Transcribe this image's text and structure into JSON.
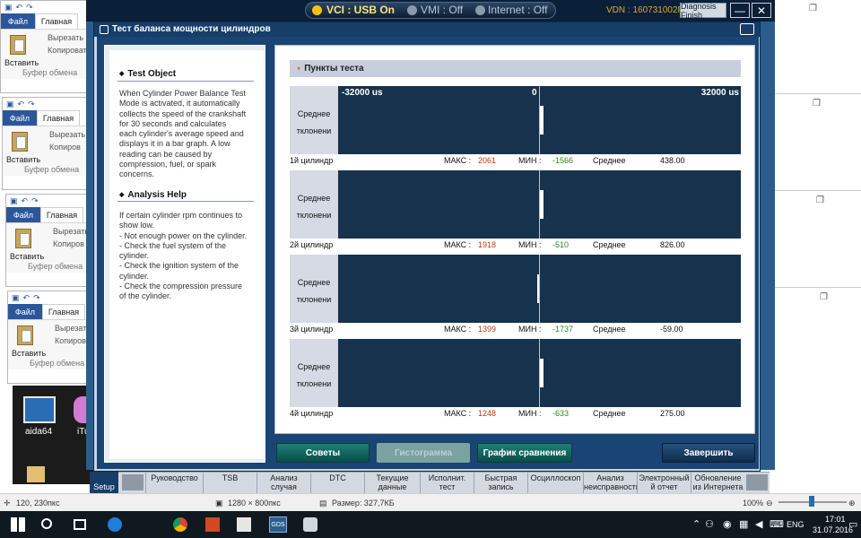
{
  "background_windows": [
    {
      "file_tab": "Файл",
      "home_tab": "Главная",
      "paste_label": "Вставить",
      "cut_label": "Вырезать",
      "copy_label": "Копировать",
      "clipboard_label": "Буфер обмена"
    },
    {
      "file_tab": "Файл",
      "home_tab": "Главная",
      "paste_label": "Вставить",
      "cut_label": "Вырезать",
      "copy_label": "Копиров",
      "clipboard_label": "Буфер обмена"
    },
    {
      "file_tab": "Файл",
      "home_tab": "Главная",
      "paste_label": "Вставить",
      "cut_label": "Вырезать",
      "copy_label": "Копиров",
      "clipboard_label": "Буфер обмена"
    },
    {
      "file_tab": "Файл",
      "home_tab": "Главная",
      "paste_label": "Вставить",
      "cut_label": "Вырезать",
      "copy_label": "Копиров",
      "clipboard_label": "Буфер обмена"
    }
  ],
  "desktop": {
    "icons": [
      {
        "label": "aida64"
      },
      {
        "label": "iTu"
      }
    ]
  },
  "topbar": {
    "vci": "VCI : USB On",
    "vmi": "VMI : Off",
    "internet": "Internet : Off",
    "vdn": "VDN : 160731002F",
    "diagnosis_button": "Diagnosis Finish",
    "minimize": "—",
    "close": "✕",
    "colors": {
      "vci_led": "#f2c21a",
      "off_led": "#8a9aad"
    }
  },
  "dialog": {
    "title": "Тест баланса мощности цилиндров",
    "left": {
      "test_object_heading": "Test Object",
      "test_object_text": "When Cylinder Power Balance Test\nMode is activated, it automatically\ncollects the speed of the crankshaft\nfor 30 seconds and calculates\neach cylinder's average speed and\ndisplays it in a bar graph. A low\nreading can be caused by\ncompression, fuel, or spark\nconcerns.",
      "analysis_heading": "Analysis Help",
      "analysis_text": "If certain cylinder rpm continues to\nshow low.\n- Not enough power on the cylinder.\n- Check the fuel system of the\ncylinder.\n- Check the ignition system of the\ncylinder.\n- Check the compression pressure\nof the cylinder."
    },
    "section_title": "Пункты теста",
    "axis": {
      "min": "-32000 us",
      "zero": "0",
      "max": "32000 us"
    },
    "row_label_line1": "Среднее",
    "row_label_line2": "тклонени",
    "cylinders": [
      {
        "name": "1й цилиндр",
        "max_label": "МАКС :",
        "max": "2061",
        "min_label": "МИН :",
        "min": "-1566",
        "avg_label": "Среднее",
        "avg": "438.00",
        "avg_value": 438
      },
      {
        "name": "2й цилиндр",
        "max_label": "МАКС :",
        "max": "1918",
        "min_label": "МИН :",
        "min": "-510",
        "avg_label": "Среднее",
        "avg": "826.00",
        "avg_value": 826
      },
      {
        "name": "3й цилиндр",
        "max_label": "МАКС :",
        "max": "1399",
        "min_label": "МИН :",
        "min": "-1737",
        "avg_label": "Среднее",
        "avg": "-59.00",
        "avg_value": -59
      },
      {
        "name": "4й цилиндр",
        "max_label": "МАКС :",
        "max": "1248",
        "min_label": "МИН :",
        "min": "-633",
        "avg_label": "Среднее",
        "avg": "275.00",
        "avg_value": 275
      }
    ],
    "buttons": {
      "tips": "Советы",
      "histogram": "Гистограмма",
      "comparison": "График сравнения",
      "finish": "Завершить"
    }
  },
  "bottom_nav": {
    "setup": "Setup",
    "items": [
      "Руководство",
      "TSB",
      "Анализ\nслучая",
      "DTC",
      "Текущие\nданные",
      "Исполнит.\nтест",
      "Быстрая\nзапись",
      "Осциллоскоп",
      "Анализ\nнеисправности",
      "Электронный\nй отчет",
      "Обновление\nиз Интернета"
    ]
  },
  "statusbar": {
    "cursor": "120, 230пкс",
    "dimensions": "1280 × 800пкс",
    "size": "Размер: 327,7КБ",
    "zoom": "100%"
  },
  "taskbar": {
    "gds_label": "GDS",
    "language": "ENG",
    "time": "17:01",
    "date": "31.07.2016"
  }
}
